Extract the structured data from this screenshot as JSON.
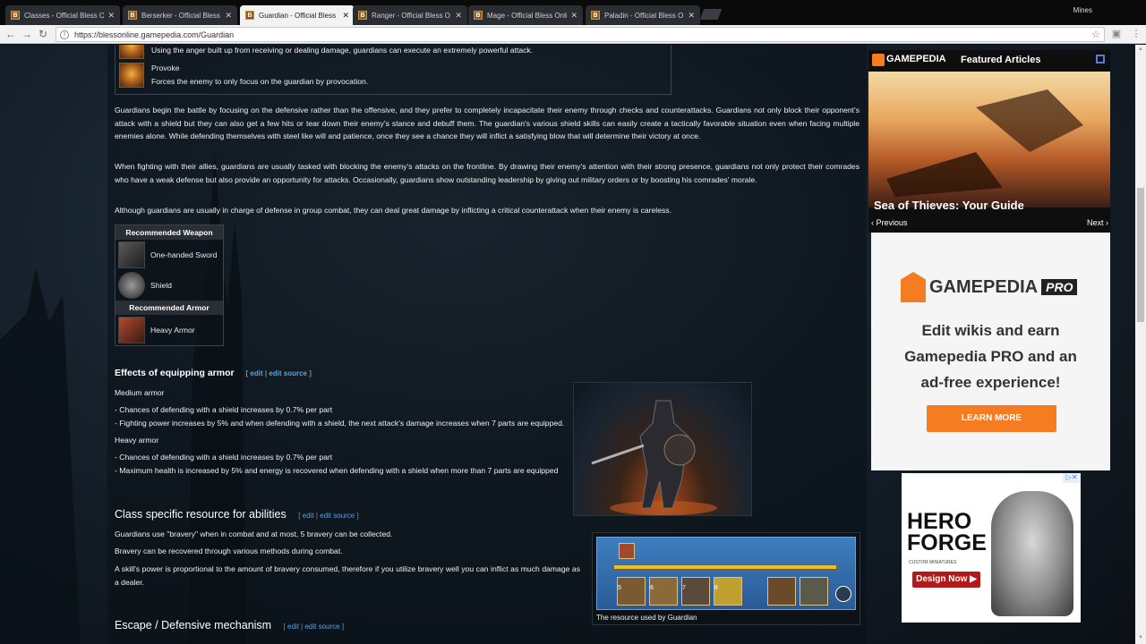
{
  "browser": {
    "tabs": [
      {
        "title": "Classes - Official Bless O",
        "active": false
      },
      {
        "title": "Berserker - Official Bless",
        "active": false
      },
      {
        "title": "Guardian - Official Bless",
        "active": true
      },
      {
        "title": "Ranger - Official Bless O",
        "active": false
      },
      {
        "title": "Mage - Official Bless Onli",
        "active": false
      },
      {
        "title": "Paladin - Official Bless O",
        "active": false
      }
    ],
    "user": "Mines",
    "url": "https://blessonline.gamepedia.com/Guardian"
  },
  "skills": [
    {
      "name": "",
      "desc": "Using the anger built up from receiving or dealing damage, guardians can execute an extremely powerful attack."
    },
    {
      "name": "Provoke",
      "desc": "Forces the enemy to only focus on the guardian by provocation."
    }
  ],
  "paragraphs": [
    "Guardians begin the battle by focusing on the defensive rather than the offensive, and they prefer to completely incapacitate their enemy through checks and counterattacks. Guardians not only block their opponent's attack with a shield but they can also get a few hits or tear down their enemy's stance and debuff them. The guardian's various shield skills can easily create a tactically favorable situation even when facing multiple enemies alone. While defending themselves with steel like will and patience, once they see a chance they will inflict a satisfying blow that will determine their victory at once.",
    "When fighting with their allies, guardians are usually tasked with blocking the enemy's attacks on the frontline. By drawing their enemy's attention with their strong presence, guardians not only protect their comrades who have a weak defense but also provide an opportunity for attacks. Occasionally, guardians show outstanding leadership by giving out military orders or by boosting his comrades' morale.",
    "Although guardians are usually in charge of defense in group combat, they can deal great damage by inflicting a critical counterattack when their enemy is careless."
  ],
  "recommended": {
    "weapon_header": "Recommended Weapon",
    "weapons": [
      "One-handed Sword",
      "Shield"
    ],
    "armor_header": "Recommended Armor",
    "armors": [
      "Heavy Armor"
    ]
  },
  "armor_effects": {
    "title": "Effects of equipping armor",
    "edit": "edit",
    "edit_source": "edit source",
    "medium_label": "Medium armor",
    "medium": [
      "- Chances of defending with a shield increases by 0.7% per part",
      "- Fighting power increases by 5% and when defending with a shield, the next attack's damage increases when 7 parts are equipped."
    ],
    "heavy_label": "Heavy armor",
    "heavy": [
      "- Chances of defending with a shield increases by 0.7% per part",
      "- Maximum health is increased by 5% and energy is recovered when defending with a shield when more than 7 parts are equipped"
    ]
  },
  "resource": {
    "title": "Class specific resource for abilities",
    "edit": "edit",
    "edit_source": "edit source",
    "lines": [
      "Guardians use \"bravery\" when in combat and at most, 5 bravery can be collected.",
      "Bravery can be recovered through various methods during combat.",
      "A skill's power is proportional to the amount of bravery consumed, therefore if you utilize bravery well you can inflict as much damage as a dealer."
    ],
    "caption": "The resource used by Guardian",
    "slot_numbers": [
      "5",
      "6",
      "7",
      "8"
    ]
  },
  "escape": {
    "title": "Escape / Defensive mechanism",
    "edit": "edit",
    "edit_source": "edit source"
  },
  "sidebar": {
    "brand": "GAMEPEDIA",
    "featured_title": "Featured Articles",
    "featured_caption": "Sea of Thieves: Your Guide",
    "prev": "‹ Previous",
    "next": "Next ›",
    "pro_word": "GAMEPEDIA",
    "pro_badge": "PRO",
    "pro_text_1": "Edit wikis and earn",
    "pro_text_2": "Gamepedia PRO and an",
    "pro_text_3": "ad-free experience!",
    "learn_more": "LEARN MORE",
    "hf_word_1": "HERO",
    "hf_word_2": "FORGE",
    "hf_sub": "CUSTOM MINIATURES",
    "hf_design": "Design Now ▶"
  }
}
